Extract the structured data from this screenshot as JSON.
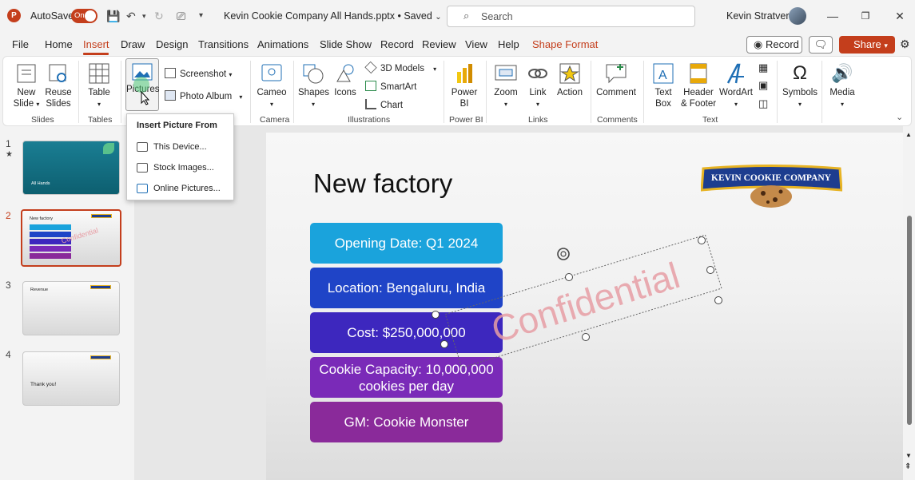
{
  "titlebar": {
    "autosave_label": "AutoSave",
    "toggle_label": "On",
    "doc_title": "Kevin Cookie Company All Hands.pptx • Saved",
    "search_placeholder": "Search",
    "user_name": "Kevin Stratvert"
  },
  "tabs": [
    "File",
    "Home",
    "Insert",
    "Draw",
    "Design",
    "Transitions",
    "Animations",
    "Slide Show",
    "Record",
    "Review",
    "View",
    "Help",
    "Shape Format"
  ],
  "active_tab": "Insert",
  "header_buttons": {
    "record": "Record",
    "share": "Share"
  },
  "ribbon": {
    "new_slide": [
      "New",
      "Slide"
    ],
    "reuse_slides": [
      "Reuse",
      "Slides"
    ],
    "table": "Table",
    "pictures": "Pictures",
    "screenshot": "Screenshot",
    "photo_album": "Photo Album",
    "cameo": "Cameo",
    "shapes": "Shapes",
    "icons": "Icons",
    "models_3d": "3D Models",
    "smartart": "SmartArt",
    "chart": "Chart",
    "power_bi": [
      "Power",
      "BI"
    ],
    "zoom": "Zoom",
    "link": "Link",
    "action": "Action",
    "comment": "Comment",
    "text_box": [
      "Text",
      "Box"
    ],
    "header_footer": [
      "Header",
      "& Footer"
    ],
    "wordart": "WordArt",
    "symbols": "Symbols",
    "media": "Media",
    "groups": [
      "Slides",
      "Tables",
      "Camera",
      "Illustrations",
      "Power BI",
      "Links",
      "Comments",
      "Text"
    ]
  },
  "insert_picture_menu": {
    "heading": "Insert Picture From",
    "items": [
      "This Device...",
      "Stock Images...",
      "Online Pictures..."
    ]
  },
  "thumbnails": [
    {
      "num": "1",
      "title": "All Hands"
    },
    {
      "num": "2",
      "title": "New factory",
      "watermark": "Confidential"
    },
    {
      "num": "3",
      "title": "Revenue"
    },
    {
      "num": "4",
      "title": "Thank you!"
    }
  ],
  "slide": {
    "title": "New factory",
    "boxes": [
      {
        "text": "Opening Date: Q1 2024",
        "color": "#1aa3dc"
      },
      {
        "text": "Location: Bengaluru, India",
        "color": "#1f44c7"
      },
      {
        "text": "Cost: $250,000,000",
        "color": "#3d27be"
      },
      {
        "text": "Cookie Capacity: 10,000,000 cookies per day",
        "color": "#7a2ab8"
      },
      {
        "text": "GM: Cookie Monster",
        "color": "#8a2a9a"
      }
    ],
    "watermark": "Confidential",
    "logo_text": "KEVIN COOKIE COMPANY"
  },
  "colors": {
    "accent": "#c43e1c"
  }
}
